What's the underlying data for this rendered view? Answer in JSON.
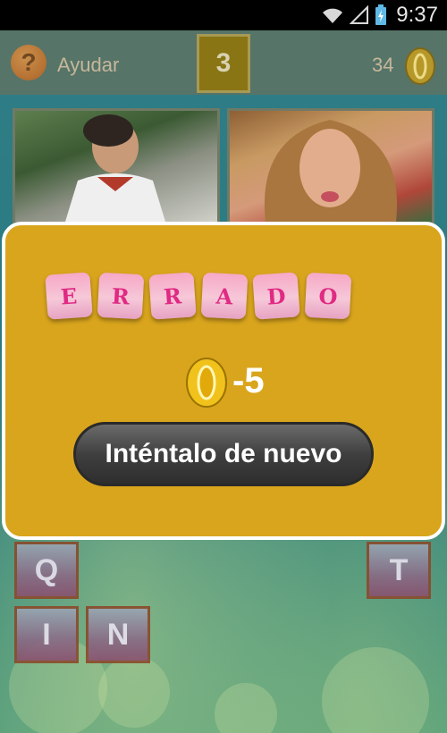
{
  "status_bar": {
    "time": "9:37"
  },
  "top_bar": {
    "help_label": "Ayudar",
    "level": "3",
    "coins": "34"
  },
  "photos": [
    {
      "name": "clue-photo-left"
    },
    {
      "name": "clue-photo-right"
    }
  ],
  "result": {
    "tiles": [
      "E",
      "R",
      "R",
      "A",
      "D",
      "O"
    ],
    "penalty": "-5",
    "retry_label": "Inténtalo de nuevo"
  },
  "letters": [
    {
      "char": "Q"
    },
    {
      "char": "T"
    },
    {
      "char": "I"
    },
    {
      "char": "N"
    }
  ],
  "colors": {
    "panel": "#d9a51d",
    "tile_text": "#e02a84",
    "button": "#3f3f3f"
  }
}
